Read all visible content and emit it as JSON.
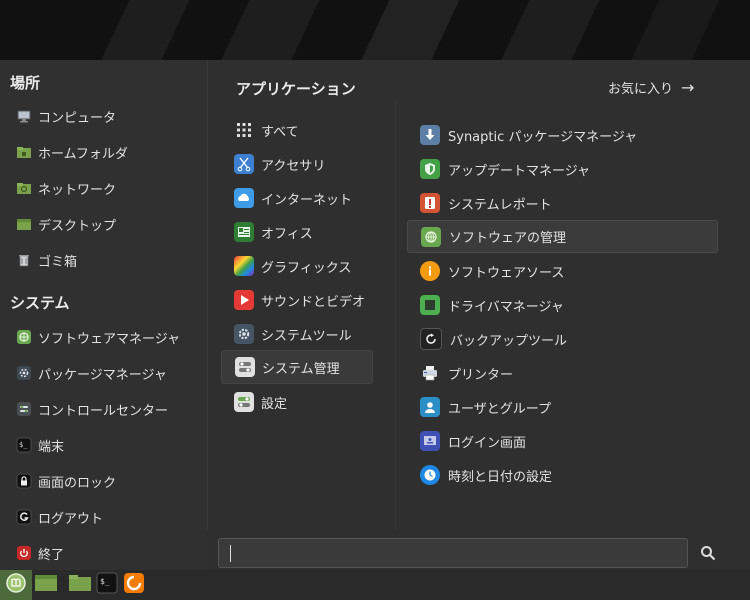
{
  "places": {
    "title": "場所",
    "items": [
      {
        "label": "コンピュータ",
        "icon": "computer-icon"
      },
      {
        "label": "ホームフォルダ",
        "icon": "home-folder-icon"
      },
      {
        "label": "ネットワーク",
        "icon": "network-folder-icon"
      },
      {
        "label": "デスクトップ",
        "icon": "desktop-folder-icon"
      },
      {
        "label": "ゴミ箱",
        "icon": "trash-icon"
      }
    ]
  },
  "system": {
    "title": "システム",
    "items": [
      {
        "label": "ソフトウェアマネージャ",
        "icon": "software-manager-icon"
      },
      {
        "label": "パッケージマネージャ",
        "icon": "package-manager-icon"
      },
      {
        "label": "コントロールセンター",
        "icon": "control-center-icon"
      },
      {
        "label": "端末",
        "icon": "terminal-icon"
      },
      {
        "label": "画面のロック",
        "icon": "lock-icon"
      },
      {
        "label": "ログアウト",
        "icon": "logout-icon"
      },
      {
        "label": "終了",
        "icon": "power-icon"
      }
    ]
  },
  "applications": {
    "title": "アプリケーション",
    "favorites_label": "お気に入り",
    "categories": [
      {
        "label": "すべて",
        "icon": "grid-icon"
      },
      {
        "label": "アクセサリ",
        "icon": "accessories-icon"
      },
      {
        "label": "インターネット",
        "icon": "internet-icon"
      },
      {
        "label": "オフィス",
        "icon": "office-icon"
      },
      {
        "label": "グラフィックス",
        "icon": "graphics-icon"
      },
      {
        "label": "サウンドとビデオ",
        "icon": "sound-video-icon"
      },
      {
        "label": "システムツール",
        "icon": "system-tools-icon"
      },
      {
        "label": "システム管理",
        "icon": "system-admin-icon",
        "selected": true
      },
      {
        "label": "設定",
        "icon": "settings-icon"
      }
    ],
    "apps": [
      {
        "label": "Synaptic パッケージマネージャ",
        "icon": "synaptic-icon"
      },
      {
        "label": "アップデートマネージャ",
        "icon": "update-manager-icon"
      },
      {
        "label": "システムレポート",
        "icon": "system-report-icon"
      },
      {
        "label": "ソフトウェアの管理",
        "icon": "software-manager-icon",
        "selected": true
      },
      {
        "label": "ソフトウェアソース",
        "icon": "software-sources-icon"
      },
      {
        "label": "ドライバマネージャ",
        "icon": "driver-manager-icon"
      },
      {
        "label": "バックアップツール",
        "icon": "backup-tool-icon"
      },
      {
        "label": "プリンター",
        "icon": "printer-icon"
      },
      {
        "label": "ユーザとグループ",
        "icon": "users-groups-icon"
      },
      {
        "label": "ログイン画面",
        "icon": "login-window-icon"
      },
      {
        "label": "時刻と日付の設定",
        "icon": "date-time-icon"
      }
    ]
  },
  "search": {
    "value": "",
    "placeholder": ""
  },
  "taskbar": {
    "items": [
      "mint-menu-icon",
      "show-desktop-icon",
      "files-icon",
      "terminal-icon",
      "firefox-icon"
    ]
  }
}
